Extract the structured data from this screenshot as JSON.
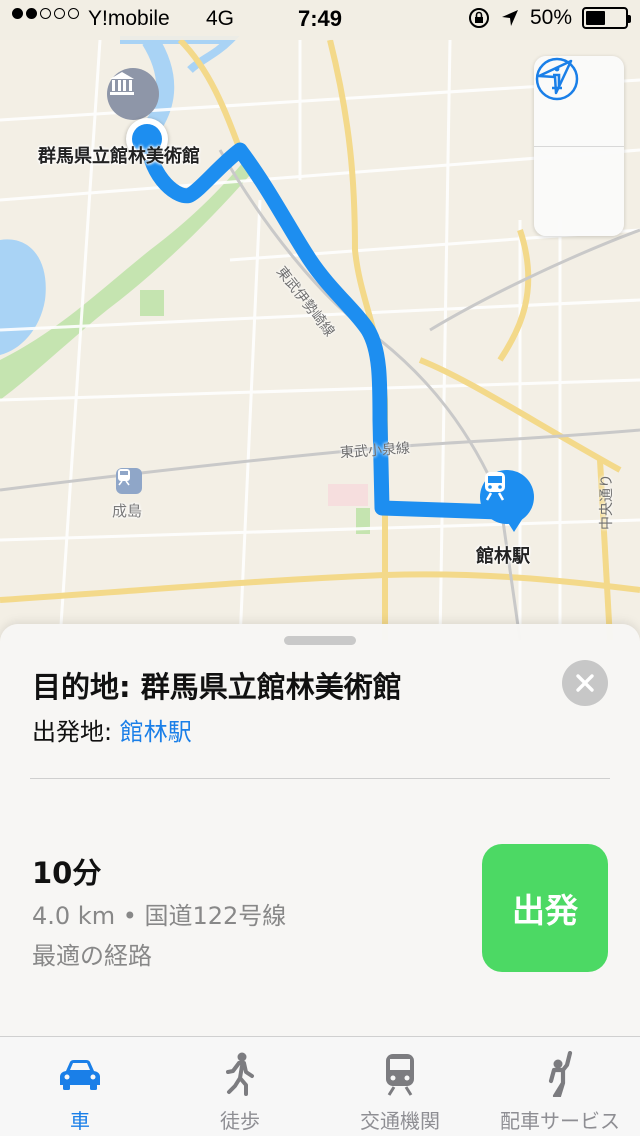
{
  "status_bar": {
    "carrier": "Y!mobile",
    "network": "4G",
    "time": "7:49",
    "battery": "50%",
    "battery_level": 0.5
  },
  "map": {
    "labels": {
      "destination": "群馬県立館林美術館",
      "origin": "館林駅",
      "station_small": "成島",
      "rail_tobu_isesaki": "東武伊勢崎線",
      "rail_tobu_koizumi": "東武小泉線",
      "road_chuo": "中央通り"
    },
    "route_color": "#1d8ef0"
  },
  "sheet": {
    "destination_prefix": "目的地: ",
    "destination_name": "群馬県立館林美術館",
    "origin_prefix": "出発地: ",
    "origin_name": "館林駅",
    "duration": "10分",
    "detail": "4.0 km • 国道122号線",
    "note": "最適の経路",
    "go_label": "出発",
    "go_color": "#4cd964"
  },
  "tabs": [
    {
      "label": "車",
      "icon": "car-icon",
      "active": true
    },
    {
      "label": "徒歩",
      "icon": "walk-icon",
      "active": false
    },
    {
      "label": "交通機関",
      "icon": "train-icon",
      "active": false
    },
    {
      "label": "配車サービス",
      "icon": "ride-hail-icon",
      "active": false
    }
  ],
  "accent_color": "#1a7fe8"
}
